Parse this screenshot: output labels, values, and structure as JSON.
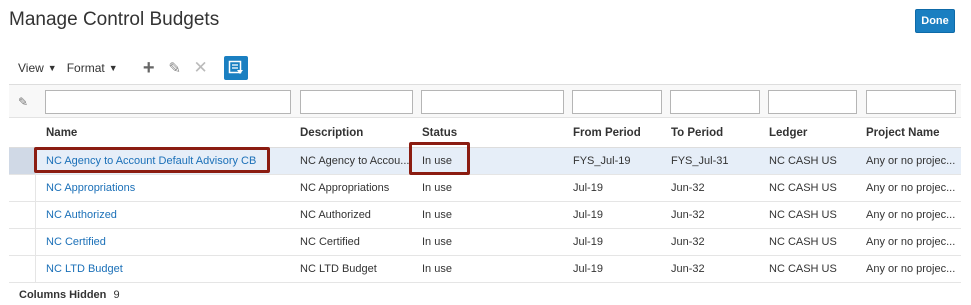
{
  "page": {
    "title": "Manage Control Budgets",
    "done_label": "Done"
  },
  "toolbar": {
    "view_label": "View",
    "format_label": "Format"
  },
  "icons": {
    "add": "plus-icon",
    "edit": "pencil-icon",
    "delete": "x-icon",
    "freeze": "freeze-icon",
    "filter_edit": "pencil-icon",
    "caret": "caret-down-icon"
  },
  "table": {
    "columns": [
      "Name",
      "Description",
      "Status",
      "From Period",
      "To Period",
      "Ledger",
      "Project Name"
    ],
    "rows": [
      {
        "name": "NC Agency to Account Default Advisory CB",
        "description": "NC Agency to Accou...",
        "status": "In use",
        "from": "FYS_Jul-19",
        "to": "FYS_Jul-31",
        "ledger": "NC CASH US",
        "project": "Any or no projec..."
      },
      {
        "name": "NC Appropriations",
        "description": "NC Appropriations",
        "status": "In use",
        "from": "Jul-19",
        "to": "Jun-32",
        "ledger": "NC CASH US",
        "project": "Any or no projec..."
      },
      {
        "name": "NC Authorized",
        "description": "NC Authorized",
        "status": "In use",
        "from": "Jul-19",
        "to": "Jun-32",
        "ledger": "NC CASH US",
        "project": "Any or no projec..."
      },
      {
        "name": "NC Certified",
        "description": "NC Certified",
        "status": "In use",
        "from": "Jul-19",
        "to": "Jun-32",
        "ledger": "NC CASH US",
        "project": "Any or no projec..."
      },
      {
        "name": "NC LTD Budget",
        "description": "NC LTD Budget",
        "status": "In use",
        "from": "Jul-19",
        "to": "Jun-32",
        "ledger": "NC CASH US",
        "project": "Any or no projec..."
      }
    ],
    "selected_row": 0
  },
  "footer": {
    "label": "Columns Hidden",
    "count": "9"
  },
  "colors": {
    "accent": "#1a7fc1",
    "link": "#1b70b8",
    "highlight": "#8b1c11",
    "selected_row": "#e6eef8"
  }
}
